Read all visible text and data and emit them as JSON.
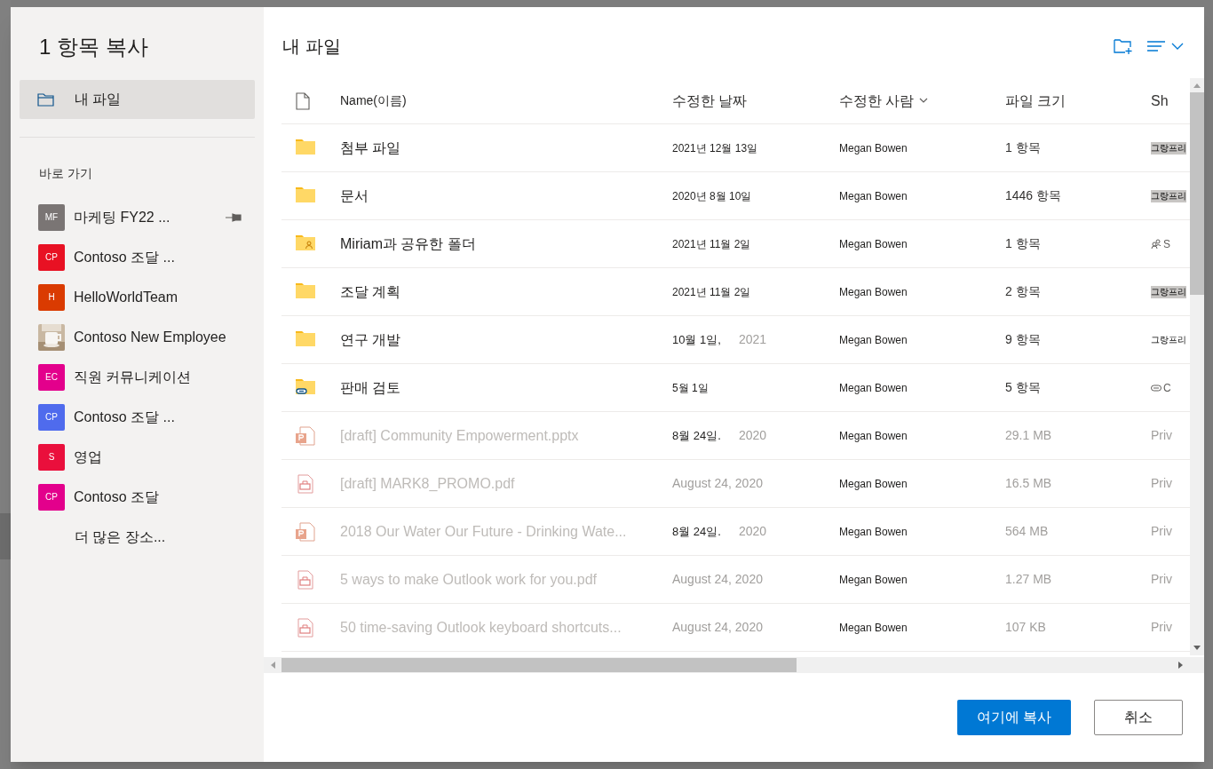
{
  "dialog": {
    "title": "1 항목 복사"
  },
  "nav": {
    "items": [
      {
        "label": "내 파일",
        "selected": true
      }
    ]
  },
  "quick_access": {
    "heading": "바로 가기",
    "places": [
      {
        "kind": "initials",
        "initials": "MF",
        "label": "마케팅 FY22 ...",
        "color": "#7a7574",
        "pinned": true
      },
      {
        "kind": "initials",
        "initials": "CP",
        "label": "Contoso 조달 ...",
        "color": "#e81123",
        "pinned": false
      },
      {
        "kind": "initials",
        "initials": "H",
        "label": "HelloWorldTeam",
        "color": "#da3b01",
        "pinned": false
      },
      {
        "kind": "picture",
        "label": "Contoso New Employee",
        "pinned": false
      },
      {
        "kind": "initials",
        "initials": "EC",
        "label": "직원 커뮤니케이션",
        "color": "#e3008c",
        "pinned": false
      },
      {
        "kind": "initials",
        "initials": "CP",
        "label": "Contoso 조달 ...",
        "color": "#4f6bed",
        "pinned": false
      },
      {
        "kind": "initials",
        "initials": "S",
        "label": "영업",
        "color": "#ea0f3c",
        "pinned": false
      },
      {
        "kind": "initials",
        "initials": "CP",
        "label": "Contoso 조달",
        "color": "#e3008c",
        "pinned": false
      }
    ],
    "more": "더 많은 장소..."
  },
  "files": {
    "title": "내 파일",
    "columns": [
      {
        "label": "Name(이름)",
        "sorted": false
      },
      {
        "label": "수정한 날짜",
        "sorted": false
      },
      {
        "label": "수정한 사람",
        "sorted": true
      },
      {
        "label": "파일 크기",
        "sorted": false
      },
      {
        "label": "Sh",
        "sorted": false
      }
    ],
    "rows": [
      {
        "kind": "folder",
        "name": "첨부 파일",
        "date": "2021년 12월 13일",
        "modified_by": "Megan Bowen",
        "size": "1 항목",
        "sharing": {
          "kind": "tag",
          "text": "그랑프리"
        },
        "disabled": false
      },
      {
        "kind": "folder",
        "name": "문서",
        "date": "2020년 8월 10일",
        "modified_by": "Megan Bowen",
        "size": "1446 항목",
        "sharing": {
          "kind": "tag",
          "text": "그랑프리"
        },
        "disabled": false
      },
      {
        "kind": "shared-folder",
        "name": "Miriam과 공유한 폴더",
        "date": "2021년 11월 2일",
        "modified_by": "Megan Bowen",
        "size": "1 항목",
        "sharing": {
          "kind": "people",
          "text": "S"
        },
        "disabled": false
      },
      {
        "kind": "folder",
        "name": "조달 계획",
        "date": "2021년 11월 2일",
        "modified_by": "Megan Bowen",
        "size": "2 항목",
        "sharing": {
          "kind": "tag",
          "text": "그랑프리"
        },
        "disabled": false
      },
      {
        "kind": "folder",
        "name": "연구 개발",
        "date": "10월 1일,",
        "year": "2021",
        "modified_by": "Megan Bowen",
        "size": "9 항목",
        "sharing": {
          "kind": "plain",
          "text": "그랑프리"
        },
        "disabled": false
      },
      {
        "kind": "link-folder",
        "name": "판매 검토",
        "date": "5월 1일",
        "modified_by": "Megan Bowen",
        "size": "5 항목",
        "sharing": {
          "kind": "link",
          "text": "C"
        },
        "disabled": false
      },
      {
        "kind": "pptx",
        "name": "[draft] Community Empowerment.pptx",
        "date": "8월 24일.",
        "year": "2020",
        "modified_by": "Megan Bowen",
        "size": "29.1 MB",
        "sharing": {
          "kind": "plain",
          "text": "Priv"
        },
        "disabled": true
      },
      {
        "kind": "pdf",
        "name": "[draft] MARK8_PROMO.pdf",
        "date": "August 24, 2020",
        "modified_by": "Megan Bowen",
        "size": "16.5 MB",
        "sharing": {
          "kind": "plain",
          "text": "Priv"
        },
        "disabled": true
      },
      {
        "kind": "pptx",
        "name": "2018 Our Water Our Future - Drinking Wate...",
        "date": "8월 24일.",
        "year": "2020",
        "modified_by": "Megan Bowen",
        "size": "564 MB",
        "sharing": {
          "kind": "plain",
          "text": "Priv"
        },
        "disabled": true
      },
      {
        "kind": "pdf",
        "name": "5 ways to make Outlook work for you.pdf",
        "date": "August 24, 2020",
        "modified_by": "Megan Bowen",
        "size": "1.27 MB",
        "sharing": {
          "kind": "plain",
          "text": "Priv"
        },
        "disabled": true
      },
      {
        "kind": "pdf",
        "name": "50 time-saving Outlook keyboard shortcuts...",
        "date": "August 24, 2020",
        "modified_by": "Megan Bowen",
        "size": "107 KB",
        "sharing": {
          "kind": "plain",
          "text": "Priv"
        },
        "disabled": true
      }
    ]
  },
  "buttons": [
    {
      "label": "여기에 복사",
      "primary": true
    },
    {
      "label": "취소",
      "primary": false
    }
  ]
}
